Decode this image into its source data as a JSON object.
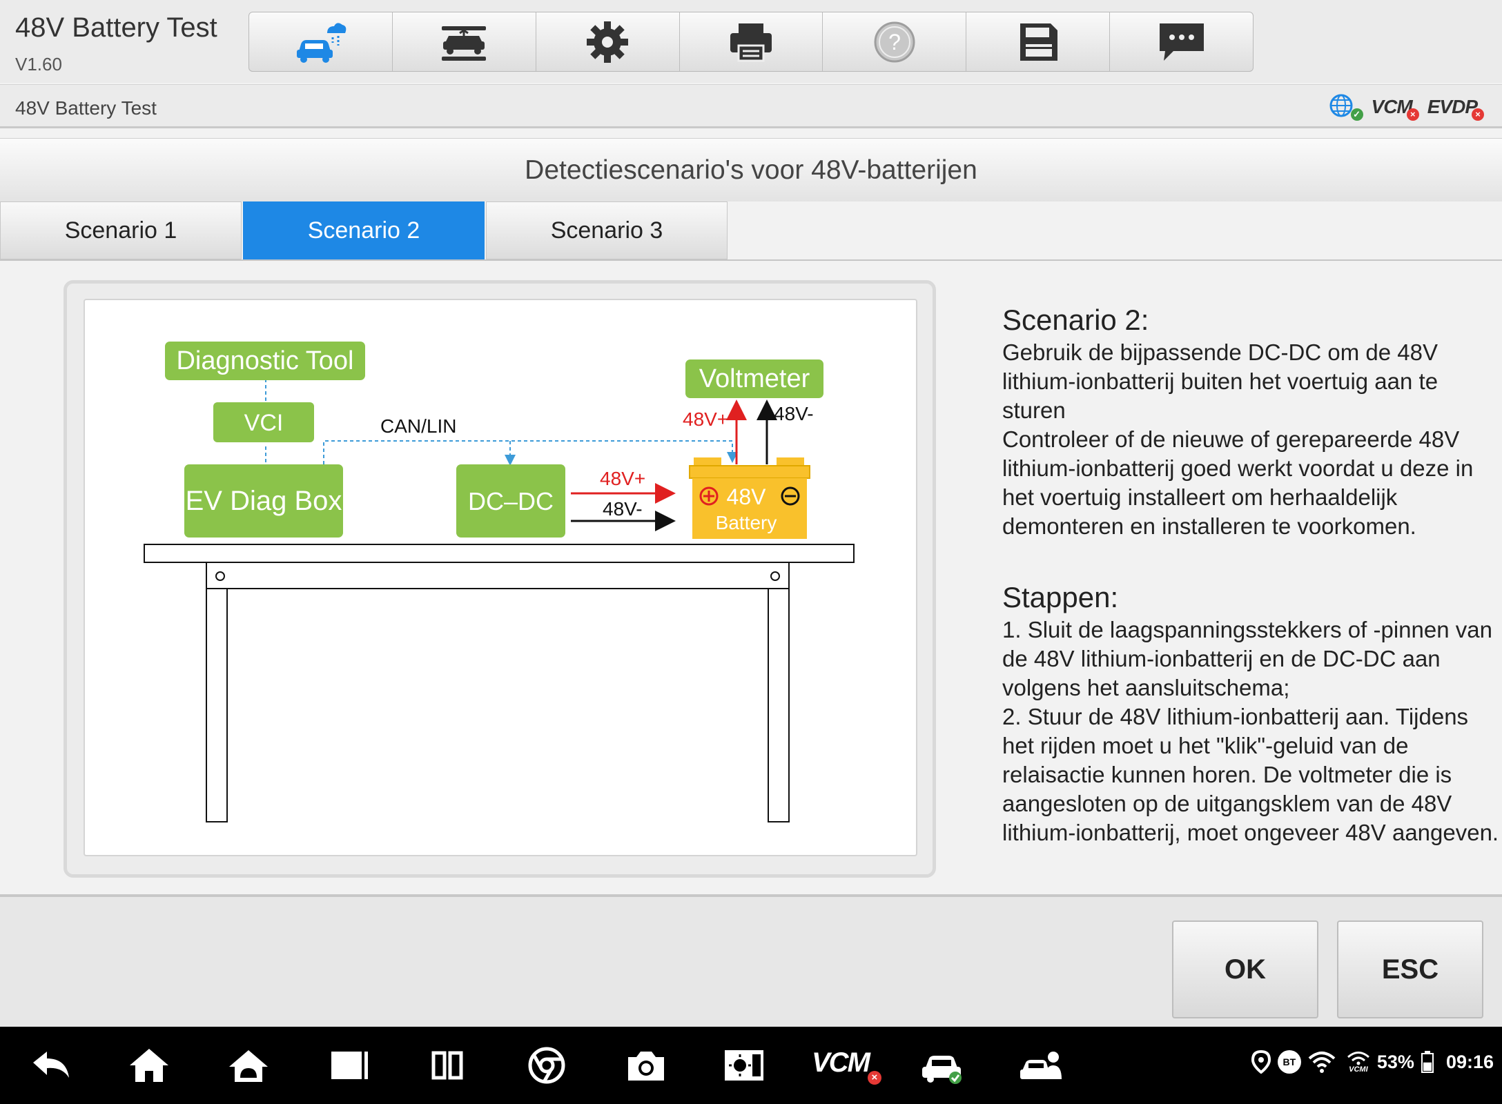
{
  "app": {
    "title": "48V Battery Test",
    "version": "V1.60"
  },
  "toolbar": {
    "buttons": [
      {
        "icon": "car-cloud-icon"
      },
      {
        "icon": "car-lift-icon"
      },
      {
        "icon": "gear-icon"
      },
      {
        "icon": "printer-icon"
      },
      {
        "icon": "help-icon"
      },
      {
        "icon": "save-icon"
      },
      {
        "icon": "chat-icon"
      }
    ]
  },
  "breadcrumb": "48V Battery Test",
  "status": {
    "vcm": "VCM",
    "evdp": "EVDP"
  },
  "page_title": "Detectiescenario's voor 48V-batterijen",
  "tabs": [
    {
      "label": "Scenario 1",
      "active": false
    },
    {
      "label": "Scenario 2",
      "active": true
    },
    {
      "label": "Scenario 3",
      "active": false
    }
  ],
  "diagram": {
    "diagnostic_tool": "Diagnostic Tool",
    "vci": "VCI",
    "ev_diag_box": "EV Diag Box",
    "dc_dc": "DC–DC",
    "voltmeter": "Voltmeter",
    "can_lin": "CAN/LIN",
    "pos_label": "48V+",
    "neg_label": "48V-",
    "battery_voltage": "48V",
    "battery_label": "Battery"
  },
  "description": {
    "scenario_heading": "Scenario 2:",
    "scenario_text_1": "Gebruik de bijpassende DC-DC om de 48V lithium-ionbatterij buiten het voertuig aan te sturen",
    "scenario_text_2": "Controleer of de nieuwe of gerepareerde 48V lithium-ionbatterij goed werkt voordat u deze in het voertuig installeert om herhaaldelijk demonteren en installeren te voorkomen.",
    "steps_heading": "Stappen:",
    "step_1": "1. Sluit de laagspanningsstekkers of -pinnen van de 48V lithium-ionbatterij en de DC-DC aan volgens het aansluitschema;",
    "step_2": "2. Stuur de 48V lithium-ionbatterij aan. Tijdens het rijden moet u het \"klik\"-geluid van de relaisactie kunnen horen. De voltmeter die is aangesloten op de uitgangsklem van de 48V lithium-ionbatterij, moet ongeveer 48V aangeven."
  },
  "actions": {
    "ok": "OK",
    "esc": "ESC"
  },
  "navbar": {
    "vcm": "VCM",
    "bt": "BT",
    "vcmi": "VCMI",
    "battery_pct": "53%",
    "time": "09:16"
  },
  "colors": {
    "accent": "#1e88e5",
    "diagram_green": "#8bc34a",
    "battery_yellow": "#f9c12c",
    "arrow_red": "#e02020",
    "link_blue": "#3d9bd8"
  }
}
